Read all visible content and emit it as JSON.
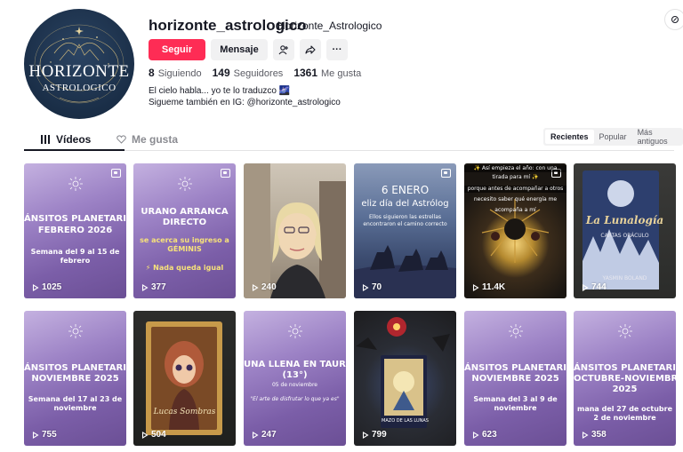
{
  "profile": {
    "avatar_line1": "HORIZONTE",
    "avatar_line2": "ASTROLOGICO",
    "username": "horizonte_astrologico",
    "nickname": "Horizonte_Astrologico",
    "follow_label": "Seguir",
    "message_label": "Mensaje",
    "add_friend_icon": "add-user-icon",
    "share_icon": "share-icon",
    "more_label": "···",
    "stats": {
      "following_count": "8",
      "following_label": "Siguiendo",
      "followers_count": "149",
      "followers_label": "Seguidores",
      "likes_count": "1361",
      "likes_label": "Me gusta"
    },
    "bio_line1": "El cielo habla... yo te lo traduzco 🌌",
    "bio_line2": "Sigueme también en IG: @horizonte_astrologico"
  },
  "tabs": {
    "videos_label": "Vídeos",
    "likes_label": "Me gusta"
  },
  "sort": {
    "recent": "Recientes",
    "popular": "Popular",
    "oldest": "Más antiguos"
  },
  "videos": [
    {
      "views": "1025",
      "line1": "ÁNSITOS PLANETARI",
      "line2": "FEBRERO 2026",
      "line3": "Semana del 9 al 15 de",
      "line4": "febrero"
    },
    {
      "views": "377",
      "line1": "URANO ARRANCA",
      "line2": "DIRECTO",
      "line3": "se acerca su ingreso a",
      "line4": "GÉMINIS",
      "line5": "⚡ Nada queda igual"
    },
    {
      "views": "240"
    },
    {
      "views": "70",
      "line1": "6 ENERO",
      "line2": "eliz día del Astrólog",
      "line3": "Ellos siguieron las estrellas",
      "line4": "encontraron el camino correcto"
    },
    {
      "views": "11.4K",
      "line1": "✨ Así empieza el año: con una",
      "line2": "tirada para mí ✨",
      "line3": "porque antes de acompañar a otros",
      "line4": "necesito saber qué energía me",
      "line5": "acompaña a mí"
    },
    {
      "views": "744",
      "line1": "La Lunalogía",
      "line2": "CARTAS ORÁCULO",
      "line3": "YASMIN BOLAND"
    },
    {
      "views": "755",
      "line1": "ÁNSITOS PLANETARI",
      "line2": "NOVIEMBRE 2025",
      "line3": "Semana del 17 al 23 de",
      "line4": "noviembre"
    },
    {
      "views": "504",
      "line1": "Lucas Sombras"
    },
    {
      "views": "247",
      "line1": "UNA LLENA EN TAURO",
      "line2": "(13°)",
      "line3": "05 de noviembre",
      "line4": "\"El arte de disfrutar lo que ya es\""
    },
    {
      "views": "799",
      "line1": "MAZO DE LAS LUNAS"
    },
    {
      "views": "623",
      "line1": "ÁNSITOS PLANETARI",
      "line2": "NOVIEMBRE 2025",
      "line3": "Semana del 3 al 9 de",
      "line4": "noviembre"
    },
    {
      "views": "358",
      "line1": "ÁNSITOS PLANETARI",
      "line2": "OCTUBRE-NOVIEMBRE",
      "line3": "2025",
      "line4": "mana del 27 de octubre",
      "line5": "2 de noviembre"
    }
  ]
}
